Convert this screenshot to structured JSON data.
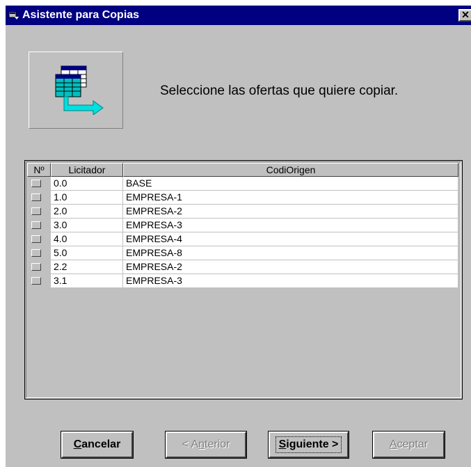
{
  "window": {
    "title": "Asistente para Copias",
    "close_symbol": "✕",
    "app_icon": "wizard-app-icon"
  },
  "banner": {
    "icon": "copy-tables-icon",
    "prompt": "Seleccione las ofertas que quiere copiar."
  },
  "grid": {
    "columns": [
      "Nº",
      "Licitador",
      "CodiOrigen"
    ],
    "rows": [
      {
        "licitador": "0.0",
        "codi_origen": "BASE"
      },
      {
        "licitador": "1.0",
        "codi_origen": "EMPRESA-1"
      },
      {
        "licitador": "2.0",
        "codi_origen": "EMPRESA-2"
      },
      {
        "licitador": "3.0",
        "codi_origen": "EMPRESA-3"
      },
      {
        "licitador": "4.0",
        "codi_origen": "EMPRESA-4"
      },
      {
        "licitador": "5.0",
        "codi_origen": "EMPRESA-8"
      },
      {
        "licitador": "2.2",
        "codi_origen": "EMPRESA-2"
      },
      {
        "licitador": "3.1",
        "codi_origen": "EMPRESA-3"
      }
    ]
  },
  "buttons": {
    "cancel": {
      "accel": "C",
      "rest": "ancelar"
    },
    "back": {
      "pre": "< A",
      "accel": "n",
      "rest": "terior"
    },
    "next": {
      "accel": "S",
      "rest": "iguiente >"
    },
    "accept": {
      "accel": "A",
      "rest": "ceptar"
    }
  },
  "colors": {
    "titlebar": "#000080",
    "face": "#c0c0c0",
    "disabled_text": "#808080"
  }
}
